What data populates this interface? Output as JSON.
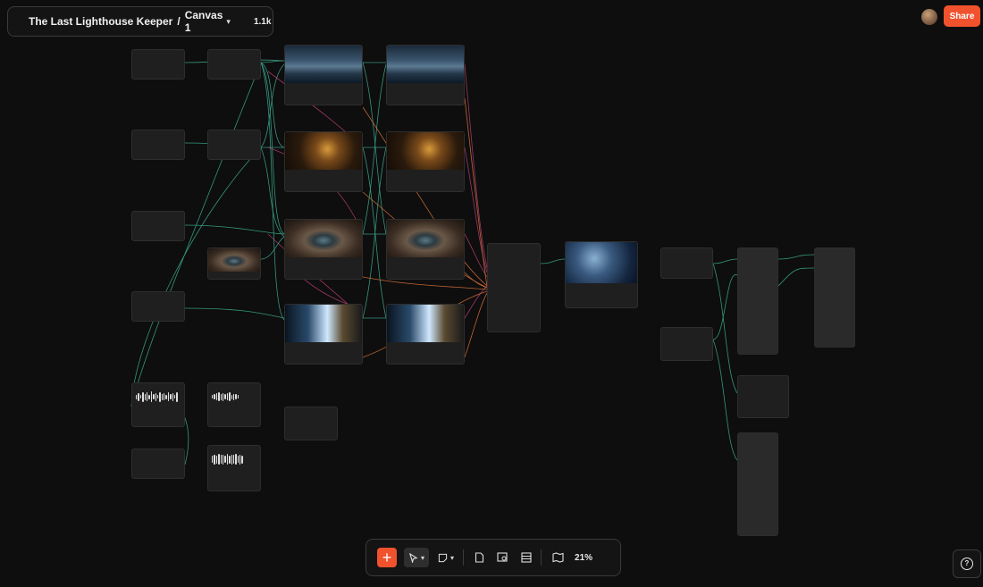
{
  "header": {
    "project_title": "The Last Lighthouse Keeper",
    "separator": "/",
    "canvas_name": "Canvas 1",
    "canvas_chevron": "chevron-down-icon",
    "viewer_count": "1.1k"
  },
  "share_label": "Share",
  "toolbar": {
    "add_label": "+",
    "zoom": "21%",
    "icons": [
      "plus-icon",
      "cursor-icon",
      "sticky-note-icon",
      "document-icon",
      "image-search-icon",
      "table-icon",
      "map-icon"
    ]
  },
  "help_label": "?",
  "colors": {
    "accent": "#f0522d",
    "background": "#0e0e0e",
    "node": "#1f1f1f",
    "wire_green": "#3aa58a",
    "wire_orange": "#e0743a",
    "wire_pink": "#c0407a"
  }
}
